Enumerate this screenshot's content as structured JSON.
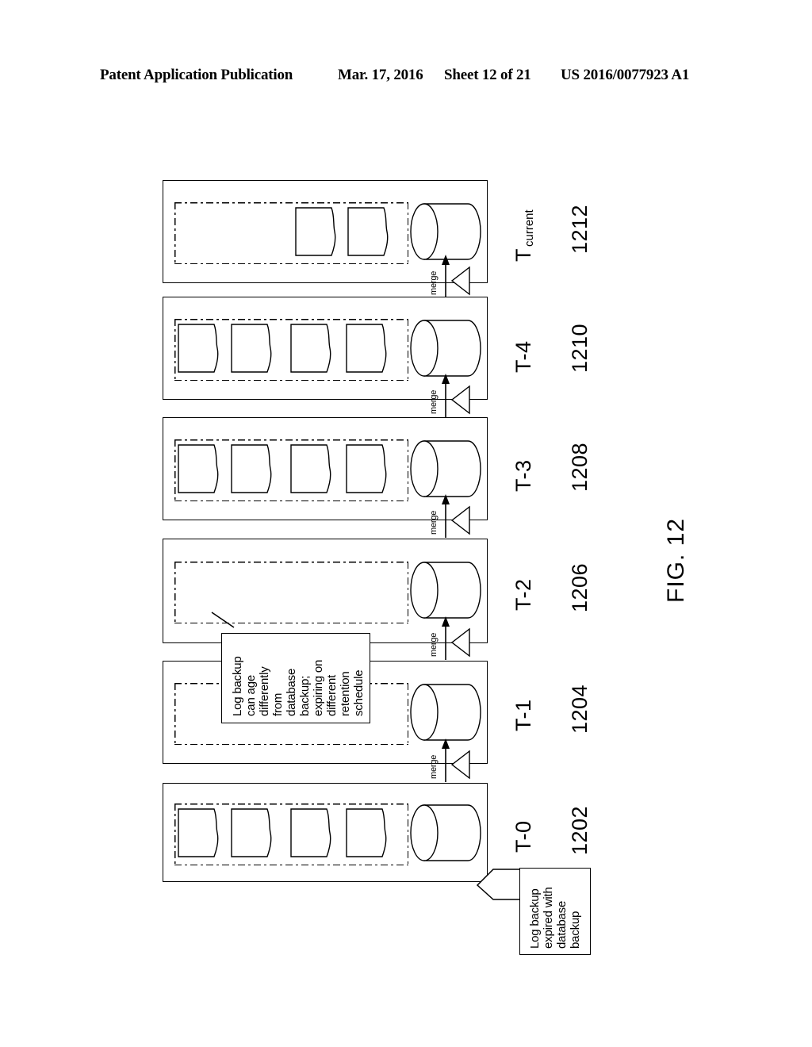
{
  "header": {
    "publication": "Patent Application Publication",
    "date": "Mar. 17, 2016",
    "sheet": "Sheet 12 of 21",
    "number": "US 2016/0077923 A1"
  },
  "figure": {
    "caption": "FIG. 12",
    "merge_label": "merge",
    "panels": [
      {
        "id": "t-current",
        "time_label": "T",
        "time_subscript": "current",
        "ref_number": "1212",
        "log_backup_count": 2,
        "log_backups_aligned": "right",
        "database_backup": "database-cylinder",
        "has_merge_arrow": true
      },
      {
        "id": "t-4",
        "time_label": "T-4",
        "time_subscript": "",
        "ref_number": "1210",
        "log_backup_count": 4,
        "log_backups_aligned": "left",
        "database_backup": "database-cylinder",
        "has_merge_arrow": true
      },
      {
        "id": "t-3",
        "time_label": "T-3",
        "time_subscript": "",
        "ref_number": "1208",
        "log_backup_count": 4,
        "log_backups_aligned": "left",
        "database_backup": "database-cylinder",
        "has_merge_arrow": true
      },
      {
        "id": "t-2",
        "time_label": "T-2",
        "time_subscript": "",
        "ref_number": "1206",
        "log_backup_count": 0,
        "log_backups_aligned": "left",
        "database_backup": "database-cylinder",
        "has_merge_arrow": true
      },
      {
        "id": "t-1",
        "time_label": "T-1",
        "time_subscript": "",
        "ref_number": "1204",
        "log_backup_count": 0,
        "log_backups_aligned": "left",
        "database_backup": "database-cylinder",
        "has_merge_arrow": true
      },
      {
        "id": "t-0",
        "time_label": "T-0",
        "time_subscript": "",
        "ref_number": "1202",
        "log_backup_count": 4,
        "log_backups_aligned": "left",
        "database_backup": "database-cylinder",
        "has_merge_arrow": false
      }
    ],
    "callouts": [
      {
        "id": "retention-callout",
        "text": "Log backup\ncan age\ndifferently\nfrom\ndatabase\nbackup;\nexpiring on\ndifferent\nretention\nschedule"
      },
      {
        "id": "expired-callout",
        "text": "Log backup\nexpired with\ndatabase\nbackup"
      }
    ]
  },
  "colors": {
    "line": "#000000",
    "background": "#ffffff"
  }
}
